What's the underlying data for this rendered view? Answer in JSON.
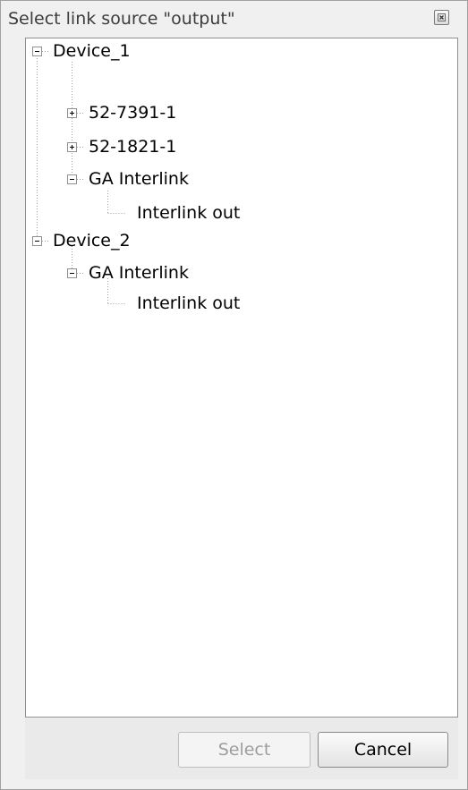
{
  "dialog": {
    "title": "Select link source \"output\"",
    "close_icon": "close-icon"
  },
  "tree": [
    {
      "label": "Device_1",
      "state": "expanded",
      "depth": 0
    },
    {
      "label": "52-7391-1",
      "state": "collapsed",
      "depth": 1
    },
    {
      "label": "52-1821-1",
      "state": "collapsed",
      "depth": 1
    },
    {
      "label": "GA Interlink",
      "state": "expanded",
      "depth": 1
    },
    {
      "label": "Interlink out",
      "state": "leaf",
      "depth": 2
    },
    {
      "label": "Device_2",
      "state": "expanded",
      "depth": 0
    },
    {
      "label": "GA Interlink",
      "state": "expanded",
      "depth": 1
    },
    {
      "label": "Interlink out",
      "state": "leaf",
      "depth": 2
    }
  ],
  "footer": {
    "select_label": "Select",
    "select_enabled": false,
    "cancel_label": "Cancel"
  },
  "colors": {
    "window_bg": "#f0f0f0",
    "tree_bg": "#ffffff",
    "disabled_text": "#9e9e9e"
  }
}
